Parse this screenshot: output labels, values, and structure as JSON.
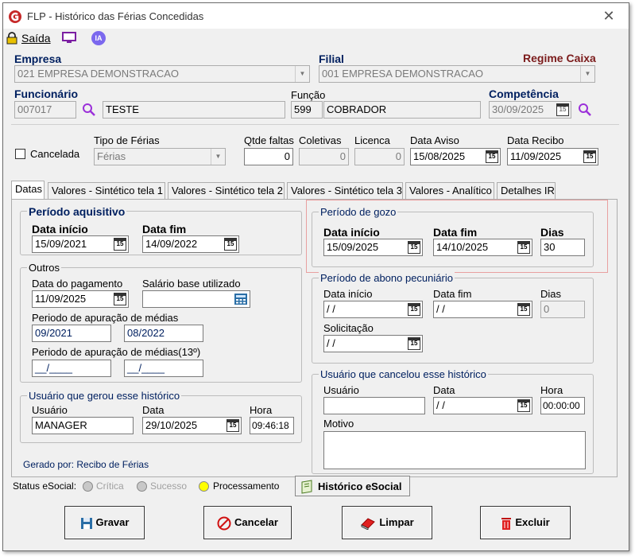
{
  "window": {
    "title": "FLP - Histórico das Férias Concedidas"
  },
  "menu": {
    "exit_label": "Saída",
    "ia_label": "IA"
  },
  "empresa": {
    "label": "Empresa",
    "value": "021 EMPRESA DEMONSTRACAO"
  },
  "filial": {
    "label": "Filial",
    "value": "001 EMPRESA DEMONSTRACAO"
  },
  "regime": {
    "label": "Regime Caixa"
  },
  "funcionario": {
    "label": "Funcionário",
    "code": "007017",
    "name": "TESTE"
  },
  "funcao": {
    "label": "Função",
    "code": "599",
    "name": "COBRADOR"
  },
  "competencia": {
    "label": "Competência",
    "value": "30/09/2025"
  },
  "cancelada": {
    "label": "Cancelada"
  },
  "tipo_ferias": {
    "label": "Tipo de Férias",
    "value": "Férias"
  },
  "qtde_faltas": {
    "label": "Qtde faltas",
    "value": "0"
  },
  "coletivas": {
    "label": "Coletivas",
    "value": "0"
  },
  "licenca": {
    "label": "Licenca",
    "value": "0"
  },
  "data_aviso": {
    "label": "Data Aviso",
    "value": "15/08/2025"
  },
  "data_recibo": {
    "label": "Data Recibo",
    "value": "11/09/2025"
  },
  "tabs": [
    {
      "label": "Datas"
    },
    {
      "label": "Valores - Sintético tela 1"
    },
    {
      "label": "Valores - Sintético tela 2"
    },
    {
      "label": "Valores - Sintético tela 3"
    },
    {
      "label": "Valores - Analítico"
    },
    {
      "label": "Detalhes IR"
    }
  ],
  "periodo_aquisitivo": {
    "title": "Período aquisitivo",
    "inicio_label": "Data início",
    "inicio": "15/09/2021",
    "fim_label": "Data fim",
    "fim": "14/09/2022"
  },
  "outros": {
    "title": "Outros",
    "pagamento_label": "Data do pagamento",
    "pagamento": "11/09/2025",
    "salario_label": "Salário base utilizado",
    "salario": "",
    "apuracao_label": "Periodo de apuração de médias",
    "apuracao_ini": "09/2021",
    "apuracao_fim": "08/2022",
    "apuracao13_label": "Periodo de apuração de médias(13º)",
    "apuracao13_ini": "__/____",
    "apuracao13_fim": "__/____"
  },
  "usuario_gerou": {
    "title": "Usuário que gerou esse histórico",
    "usuario_label": "Usuário",
    "usuario": "MANAGER",
    "data_label": "Data",
    "data": "29/10/2025",
    "hora_label": "Hora",
    "hora": "09:46:18"
  },
  "gerado_por": "Gerado por: Recibo de Férias",
  "periodo_gozo": {
    "title": "Período de gozo",
    "inicio_label": "Data início",
    "inicio": "15/09/2025",
    "fim_label": "Data fim",
    "fim": "14/10/2025",
    "dias_label": "Dias",
    "dias": "30"
  },
  "abono": {
    "title": "Período de abono pecuniário",
    "inicio_label": "Data início",
    "inicio": " / /",
    "fim_label": "Data fim",
    "fim": " / /",
    "dias_label": "Dias",
    "dias": "0",
    "solicitacao_label": "Solicitação",
    "solicitacao": " / /"
  },
  "usuario_cancelou": {
    "title": "Usuário que cancelou esse histórico",
    "usuario_label": "Usuário",
    "usuario": "",
    "data_label": "Data",
    "data": " / /",
    "hora_label": "Hora",
    "hora": "00:00:00",
    "motivo_label": "Motivo",
    "motivo": ""
  },
  "status": {
    "label": "Status eSocial:",
    "critica": "Crítica",
    "sucesso": "Sucesso",
    "processamento": "Processamento",
    "historico_button": "Histórico eSocial",
    "colors": {
      "critica": "#c8c8c8",
      "sucesso": "#c8c8c8",
      "processamento": "#ffff00"
    }
  },
  "buttons": {
    "gravar": "Gravar",
    "cancelar": "Cancelar",
    "limpar": "Limpar",
    "excluir": "Excluir"
  },
  "colors": {
    "label_blue": "#002060",
    "regime_red": "#7b1b1b",
    "highlight_border": "#e8a0a0",
    "search_purple": "#9b30d9"
  },
  "cal_glyph": "15"
}
